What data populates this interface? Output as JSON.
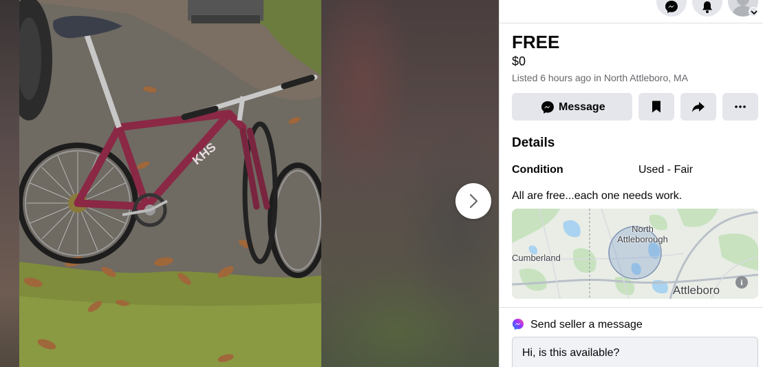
{
  "listing": {
    "title": "FREE",
    "price": "$0",
    "listed_text": "Listed 6 hours ago in North Attleboro, MA"
  },
  "actions": {
    "message_label": "Message",
    "save_icon": "bookmark-icon",
    "share_icon": "share-icon",
    "more_icon": "more-icon"
  },
  "details": {
    "heading": "Details",
    "condition_label": "Condition",
    "condition_value": "Used - Fair",
    "description": "All are free...each one needs work."
  },
  "map": {
    "label_north": "North\nAttleborough",
    "label_cumberland": "Cumberland",
    "label_attleboro": "Attleboro",
    "info_symbol": "i"
  },
  "send_message": {
    "heading": "Send seller a message",
    "input_value": "Hi, is this available?"
  },
  "topbar_icons": [
    "messenger-icon",
    "notifications-icon",
    "account-avatar"
  ],
  "colors": {
    "accent_messenger": "#a033ff",
    "button_bg": "#e4e6eb",
    "text_secondary": "#65676b"
  }
}
